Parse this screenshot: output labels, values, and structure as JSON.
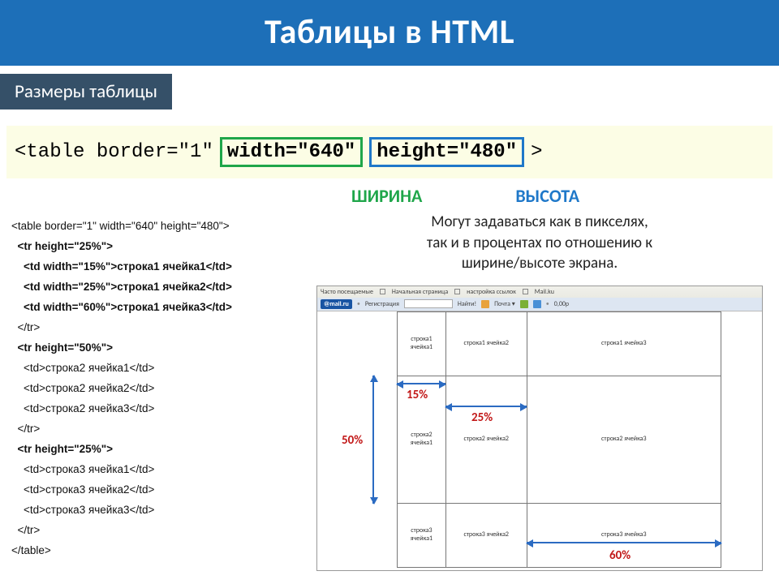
{
  "title": "Таблицы в HTML",
  "subtitle": "Размеры таблицы",
  "code_line": {
    "prefix": "<table border=\"1\"",
    "width_attr": "width=\"640\"",
    "height_attr": "height=\"480\"",
    "suffix": ">"
  },
  "labels": {
    "width": "ШИРИНА",
    "height": "ВЫСОТА"
  },
  "description": "Могут задаваться как в пикселях,\nтак и в процентах по отношению к\nширине/высоте экрана.",
  "code_block": [
    {
      "t": "<table border=\"1\" width=\"640\" height=\"480\">",
      "b": false,
      "i": 0
    },
    {
      "t": "<tr height=\"25%\">",
      "b": true,
      "i": 1
    },
    {
      "t": "<td width=\"15%\">строка1 ячейка1</td>",
      "b": true,
      "i": 2
    },
    {
      "t": "<td width=\"25%\">строка1 ячейка2</td>",
      "b": true,
      "i": 2
    },
    {
      "t": "<td width=\"60%\">строка1 ячейка3</td>",
      "b": true,
      "i": 2
    },
    {
      "t": "</tr>",
      "b": false,
      "i": 1
    },
    {
      "t": "<tr height=\"50%\">",
      "b": true,
      "i": 1
    },
    {
      "t": "<td>строка2 ячейка1</td>",
      "b": false,
      "i": 2
    },
    {
      "t": "<td>строка2 ячейка2</td>",
      "b": false,
      "i": 2
    },
    {
      "t": "<td>строка2 ячейка3</td>",
      "b": false,
      "i": 2
    },
    {
      "t": "</tr>",
      "b": false,
      "i": 1
    },
    {
      "t": "<tr height=\"25%\">",
      "b": true,
      "i": 1
    },
    {
      "t": "<td>строка3 ячейка1</td>",
      "b": false,
      "i": 2
    },
    {
      "t": "<td>строка3 ячейка2</td>",
      "b": false,
      "i": 2
    },
    {
      "t": "<td>строка3 ячейка3</td>",
      "b": false,
      "i": 2
    },
    {
      "t": "</tr>",
      "b": false,
      "i": 1
    },
    {
      "t": "</table>",
      "b": false,
      "i": 0
    }
  ],
  "browser_toolbar": {
    "row1": [
      "Часто посещаемые",
      "Начальная страница",
      "настройка ссылок",
      "Mail.ku"
    ],
    "row2": [
      "@mail.ru",
      "Регистрация",
      "Найти!",
      "Почта ▾",
      "0,00р"
    ]
  },
  "table_cells": [
    [
      "строка1\nячейка1",
      "строка1 ячейка2",
      "строка1 ячейка3"
    ],
    [
      "строка2\nячейка1",
      "строка2 ячейка2",
      "строка2 ячейка3"
    ],
    [
      "строка3\nячейка1",
      "строка3 ячейка2",
      "строка3 ячейка3"
    ]
  ],
  "table_layout": {
    "col_widths_pct": [
      15,
      25,
      60
    ],
    "row_heights_pct": [
      25,
      50,
      25
    ]
  },
  "dimensions": {
    "col1": "15%",
    "col2": "25%",
    "row2": "50%",
    "col3": "60%"
  }
}
